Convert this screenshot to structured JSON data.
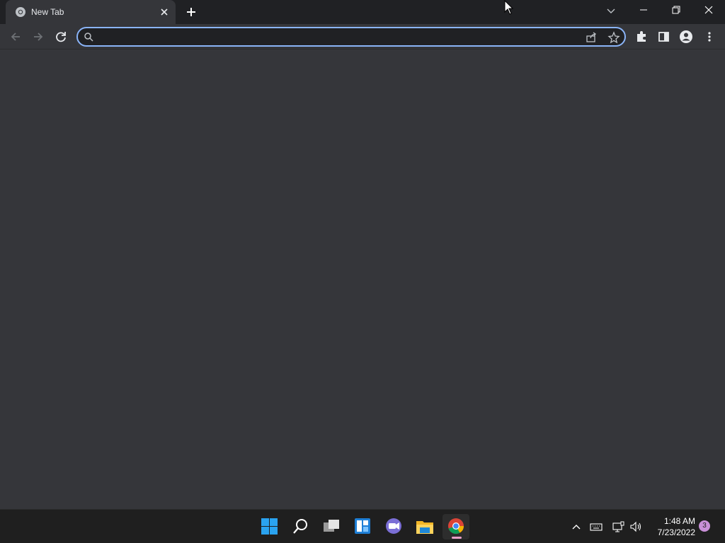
{
  "browser": {
    "tab": {
      "title": "New Tab",
      "favicon": "chrome-icon"
    },
    "omnibox": {
      "value": "",
      "placeholder": ""
    },
    "accent_color": "#8ab4f8"
  },
  "taskbar": {
    "apps": [
      {
        "name": "start-icon"
      },
      {
        "name": "search-icon"
      },
      {
        "name": "task-view-icon"
      },
      {
        "name": "widgets-icon"
      },
      {
        "name": "teams-chat-icon"
      },
      {
        "name": "file-explorer-icon"
      },
      {
        "name": "chrome-icon",
        "active": true
      }
    ],
    "clock": {
      "time": "1:48 AM",
      "date": "7/23/2022"
    },
    "notifications": "3"
  }
}
